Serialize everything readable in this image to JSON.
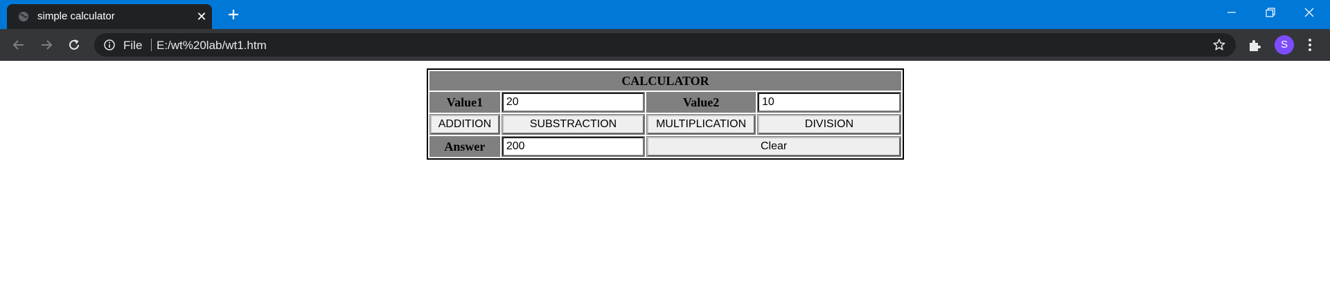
{
  "browser": {
    "tab_title": "simple calculator",
    "address_scheme": "File",
    "address_url": "E:/wt%20lab/wt1.htm",
    "profile_initial": "S",
    "accent_color": "#0078d7",
    "avatar_color": "#7c4dff"
  },
  "calculator": {
    "title": "CALCULATOR",
    "value1_label": "Value1",
    "value1": "20",
    "value2_label": "Value2",
    "value2": "10",
    "buttons": {
      "addition": "ADDITION",
      "subtraction": "SUBSTRACTION",
      "multiplication": "MULTIPLICATION",
      "division": "DIVISION",
      "clear": "Clear"
    },
    "answer_label": "Answer",
    "answer": "200"
  }
}
